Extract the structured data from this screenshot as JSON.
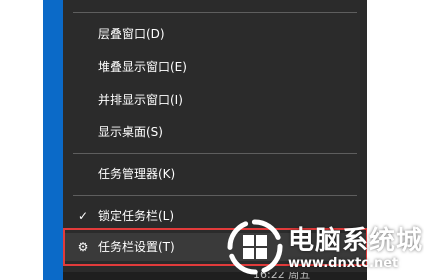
{
  "menu": {
    "items": [
      {
        "label": "层叠窗口(D)",
        "icon": ""
      },
      {
        "label": "堆叠显示窗口(E)",
        "icon": ""
      },
      {
        "label": "并排显示窗口(I)",
        "icon": ""
      },
      {
        "label": "显示桌面(S)",
        "icon": ""
      },
      {
        "label": "任务管理器(K)",
        "icon": ""
      },
      {
        "label": "锁定任务栏(L)",
        "icon": "checkmark-icon",
        "checked": true
      },
      {
        "label": "任务栏设置(T)",
        "icon": "gear-icon",
        "highlighted": true
      }
    ]
  },
  "glyphs": {
    "check": "✓",
    "gear": "⚙"
  },
  "taskbar": {
    "clock_fragment": "16:22 周五"
  },
  "watermark": {
    "title": "电脑系统城",
    "url": "www.dnxtc.net"
  },
  "colors": {
    "menu_bg": "#2b2b2b",
    "highlight_box": "#e23b3b",
    "taskbar_blue": "#0b6ac8"
  }
}
